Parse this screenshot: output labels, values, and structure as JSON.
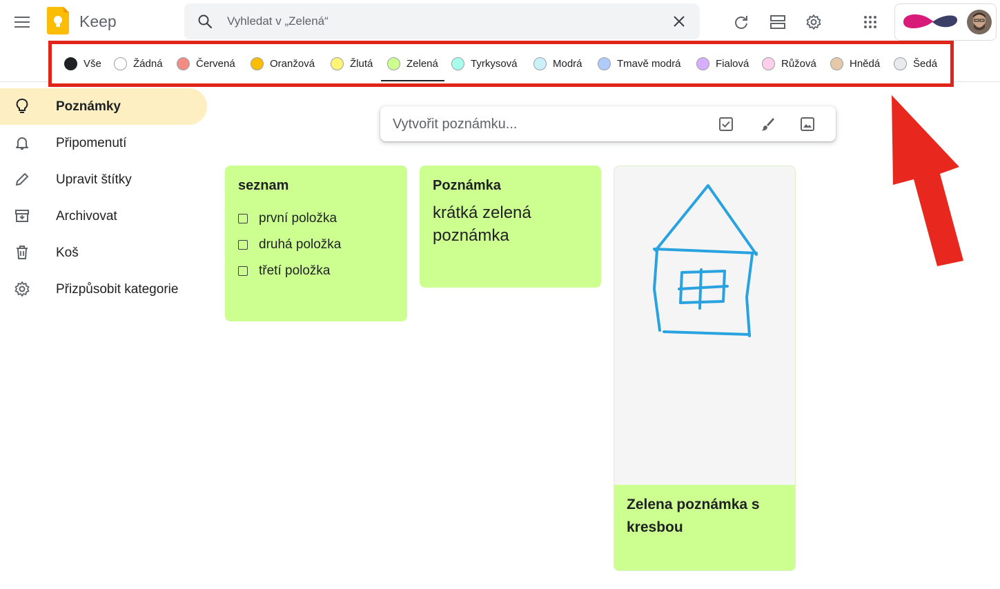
{
  "header": {
    "app_title": "Keep",
    "search_placeholder": "Vyhledat v „Zelená“"
  },
  "colors": {
    "brand_yellow": "#fbbc04",
    "active_nav_bg": "#feefc3",
    "note_green": "#ccff90",
    "annotation_red": "#e02418",
    "drawing_blue": "#29a3e0"
  },
  "filters": [
    {
      "label": "Vše",
      "color": "#202124"
    },
    {
      "label": "Žádná",
      "color": "#ffffff"
    },
    {
      "label": "Červená",
      "color": "#f28b82"
    },
    {
      "label": "Oranžová",
      "color": "#fbbc04"
    },
    {
      "label": "Žlutá",
      "color": "#fff475"
    },
    {
      "label": "Zelená",
      "color": "#ccff90",
      "active": true
    },
    {
      "label": "Tyrkysová",
      "color": "#a7ffeb"
    },
    {
      "label": "Modrá",
      "color": "#cbf0f8"
    },
    {
      "label": "Tmavě modrá",
      "color": "#aecbfa"
    },
    {
      "label": "Fialová",
      "color": "#d7aefb"
    },
    {
      "label": "Růžová",
      "color": "#fdcfe8"
    },
    {
      "label": "Hnědá",
      "color": "#e6c9a8"
    },
    {
      "label": "Šedá",
      "color": "#e8eaed"
    }
  ],
  "sidebar": {
    "items": [
      {
        "label": "Poznámky",
        "icon": "lightbulb-icon",
        "active": true
      },
      {
        "label": "Připomenutí",
        "icon": "bell-icon"
      },
      {
        "label": "Upravit štítky",
        "icon": "pencil-icon"
      },
      {
        "label": "Archivovat",
        "icon": "archive-icon"
      },
      {
        "label": "Koš",
        "icon": "trash-icon"
      },
      {
        "label": "Přizpůsobit kategorie",
        "icon": "gear-icon"
      }
    ]
  },
  "take_note": {
    "placeholder": "Vytvořit poznámku..."
  },
  "notes": [
    {
      "title": "seznam",
      "items": [
        "první položka",
        "druhá položka",
        "třetí položka"
      ]
    },
    {
      "title": "Poznámka",
      "body": "krátká zelená poznámka"
    },
    {
      "title": "Zelena poznámka s kresbou",
      "has_drawing": true
    }
  ]
}
